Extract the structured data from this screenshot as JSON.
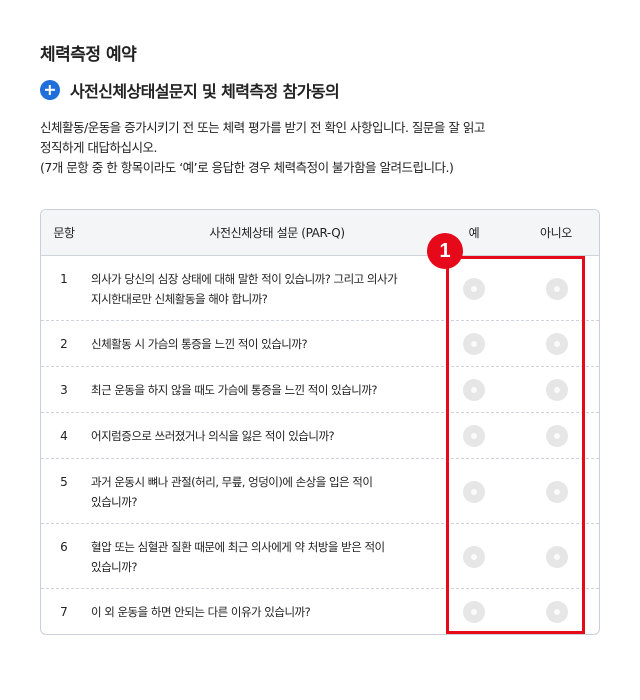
{
  "page": {
    "title": "체력측정 예약"
  },
  "section": {
    "icon": "plus-circle-icon",
    "heading": "사전신체상태설문지 및 체력측정 참가동의"
  },
  "description": {
    "line1": "신체활동/운동을 증가시키기 전 또는 체력 평가를 받기 전 확인 사항입니다. 질문을 잘 읽고",
    "line2": "정직하게 대답하십시오.",
    "line3": "(7개 문항 중 한 항목이라도 ‘예’로 응답한 경우 체력측정이 불가함을 알려드립니다.)"
  },
  "table": {
    "headers": {
      "number": "문항",
      "question": "사전신체상태 설문 (PAR-Q)",
      "yes": "예",
      "no": "아니오"
    },
    "rows": [
      {
        "num": "1",
        "lines": [
          "의사가 당신의 심장 상태에 대해 말한 적이 있습니까? 그리고 의사가",
          "지시한대로만 신체활동을 해야 합니까?"
        ]
      },
      {
        "num": "2",
        "lines": [
          "신체활동 시 가슴의 통증을 느낀 적이 있습니까?"
        ]
      },
      {
        "num": "3",
        "lines": [
          "최근 운동을 하지 않을 때도 가슴에 통증을 느낀 적이 있습니까?"
        ]
      },
      {
        "num": "4",
        "lines": [
          "어지럼증으로 쓰러졌거나 의식을 잃은 적이 있습니까?"
        ]
      },
      {
        "num": "5",
        "lines": [
          "과거 운동시 뼈나 관절(허리, 무릎, 엉덩이)에 손상을 입은 적이",
          "있습니까?"
        ]
      },
      {
        "num": "6",
        "lines": [
          "혈압 또는 심혈관 질환 때문에 최근 의사에게 약 처방을 받은 적이",
          "있습니까?"
        ]
      },
      {
        "num": "7",
        "lines": [
          "이 외 운동을 하면 안되는 다른 이유가 있습니까?"
        ]
      }
    ]
  },
  "annotation": {
    "badge": "1",
    "color": "#e5091a"
  }
}
